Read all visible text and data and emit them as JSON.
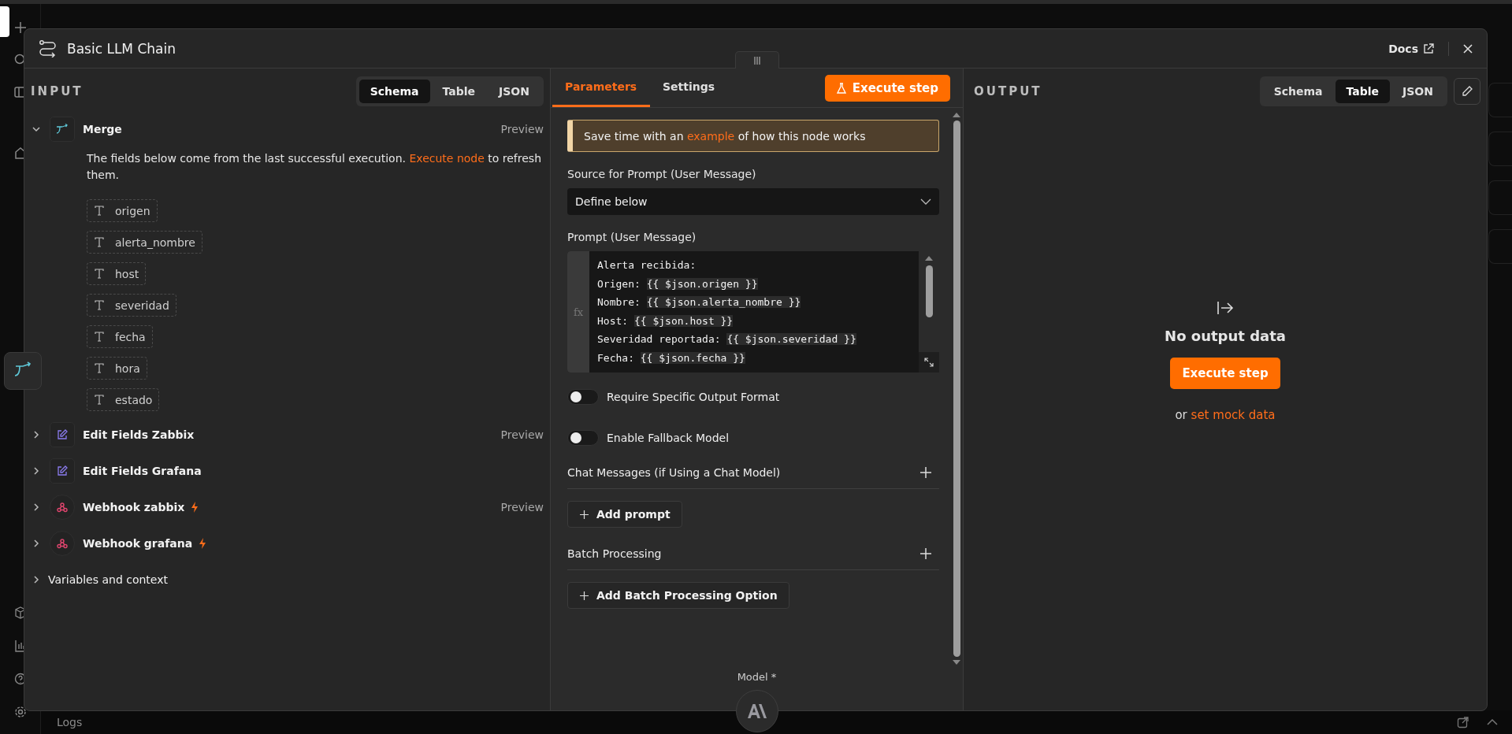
{
  "logs_bar": {
    "label": "Logs"
  },
  "dialog": {
    "title": "Basic LLM Chain",
    "docs_link": "Docs"
  },
  "input_panel": {
    "heading": "INPUT",
    "view_tabs": [
      {
        "label": "Schema",
        "selected": true
      },
      {
        "label": "Table",
        "selected": false
      },
      {
        "label": "JSON",
        "selected": false
      }
    ],
    "nodes": [
      {
        "name": "Merge",
        "kind": "merge",
        "expanded": true,
        "trigger": false,
        "preview": "Preview",
        "notice": {
          "before": "The fields below come from the last successful execution. ",
          "link": "Execute node",
          "after": " to refresh them."
        },
        "fields": [
          "origen",
          "alerta_nombre",
          "host",
          "severidad",
          "fecha",
          "hora",
          "estado"
        ]
      },
      {
        "name": "Edit Fields Zabbix",
        "kind": "edit",
        "expanded": false,
        "trigger": false,
        "preview": "Preview"
      },
      {
        "name": "Edit Fields Grafana",
        "kind": "edit",
        "expanded": false,
        "trigger": false
      },
      {
        "name": "Webhook zabbix",
        "kind": "webhook",
        "expanded": false,
        "trigger": true,
        "preview": "Preview"
      },
      {
        "name": "Webhook grafana",
        "kind": "webhook",
        "expanded": false,
        "trigger": true
      }
    ],
    "variables": {
      "label": "Variables and context",
      "expanded": false
    }
  },
  "parameters_panel": {
    "tabs": [
      {
        "label": "Parameters",
        "selected": true
      },
      {
        "label": "Settings",
        "selected": false
      }
    ],
    "execute_button": "Execute step",
    "hint": {
      "before": "Save time with an ",
      "link": "example",
      "after": " of how this node works"
    },
    "source": {
      "label": "Source for Prompt (User Message)",
      "value": "Define below"
    },
    "prompt": {
      "label": "Prompt (User Message)",
      "gutter_label": "fx",
      "lines": [
        {
          "text": "Alerta recibida:"
        },
        {
          "text": "Origen: ",
          "expression": "{{ $json.origen }}"
        },
        {
          "text": "Nombre: ",
          "expression": "{{ $json.alerta_nombre }}"
        },
        {
          "text": "Host: ",
          "expression": "{{ $json.host }}"
        },
        {
          "text": "Severidad reportada: ",
          "expression": "{{ $json.severidad }}"
        },
        {
          "text": "Fecha: ",
          "expression": "{{ $json.fecha }}"
        }
      ]
    },
    "toggles": [
      {
        "label": "Require Specific Output Format",
        "on": false
      },
      {
        "label": "Enable Fallback Model",
        "on": false
      }
    ],
    "collections": [
      {
        "label": "Chat Messages (if Using a Chat Model)",
        "button": "Add prompt"
      },
      {
        "label": "Batch Processing",
        "button": "Add Batch Processing Option"
      }
    ],
    "model_label": "Model *"
  },
  "output_panel": {
    "heading": "OUTPUT",
    "view_tabs": [
      {
        "label": "Schema",
        "selected": false
      },
      {
        "label": "Table",
        "selected": true
      },
      {
        "label": "JSON",
        "selected": false
      }
    ],
    "empty_title": "No output data",
    "execute_button": "Execute step",
    "mock_prefix": "or",
    "mock_link": "set mock data"
  }
}
